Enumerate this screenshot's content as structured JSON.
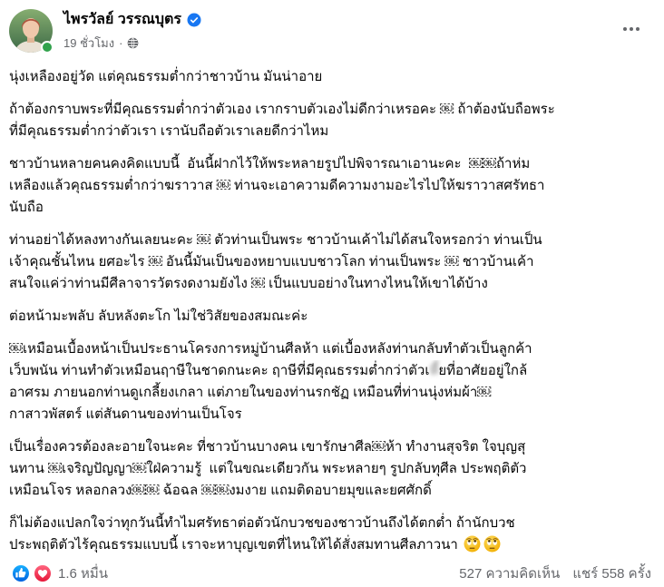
{
  "theme": {
    "accent": "#1877F2",
    "text": "#050505",
    "secondary_text": "#65676B",
    "online": "#31A24C",
    "love": "#F33E58"
  },
  "post": {
    "author": {
      "name": "ไพรวัลย์ วรรณบุตร",
      "verified": true,
      "online": true
    },
    "meta": {
      "time": "19 ชั่วโมง",
      "separator": "·",
      "audience_icon": "globe-icon"
    },
    "menu_icon": "more-horizontal-icon",
    "paragraphs": [
      {
        "lines": [
          "นุ่งเหลืองอยู่วัด แต่คุณธรรมต่ำกว่าชาวบ้าน มันน่าอาย"
        ]
      },
      {
        "lines": [
          "ถ้าต้องกราบพระที่มีคุณธรรมต่ำกว่าตัวเอง เรากราบตัวเองไม่ดีกว่าเหรอคะ ￼ ถ้าต้องนับถือพระ",
          "ที่มีคุณธรรมต่ำกว่าตัวเรา เรานับถือตัวเราเลยดีกว่าไหม"
        ]
      },
      {
        "lines": [
          "ชาวบ้านหลายคนคงคิดแบบนี้  อันนี้ฝากไว้ให้พระหลายรูปไปพิจารณาเอานะคะ  ￼￼ถ้าห่ม",
          "เหลืองแล้วคุณธรรมต่ำกว่าฆราวาส ￼ ท่านจะเอาความดีความงามอะไรไปให้ฆราวาสศรัทธา",
          "นับถือ"
        ]
      },
      {
        "lines": [
          "ท่านอย่าได้หลงทางกันเลยนะคะ ￼ ตัวท่านเป็นพระ ชาวบ้านเค้าไม่ได้สนใจหรอกว่า ท่านเป็น",
          "เจ้าคุณชั้นไหน ยศอะไร ￼ อันนี้มันเป็นของหยาบแบบชาวโลก ท่านเป็นพระ ￼ ชาวบ้านเค้า",
          "สนใจแค่ว่าท่านมีศีลาจารวัตรงดงามยังไง ￼ เป็นแบบอย่างในทางไหนให้เขาได้บ้าง"
        ]
      },
      {
        "lines": [
          "ต่อหน้ามะพลับ ลับหลังตะโก ไม่ใช่วิสัยของสมณะค่ะ"
        ]
      },
      {
        "lines": [
          "￼เหมือนเบื้องหน้าเป็นประธานโครงการหมู่บ้านศีลห้า แต่เบื้องหลังท่านกลับทำตัวเป็นลูกค้า",
          {
            "before": "เว็บพนัน ท่านทำตัวเหมือนฤาษีในชาดกนะคะ ฤาษีที่มีคุณธรรมต่ำกว่าตัวเ",
            "blurred": "หี้",
            "after": "ยที่อาศัยอยู่ใกล้"
          },
          "อาศรม ภายนอกท่านดูเกลี้ยงเกลา แต่ภายในของท่านรกชัฏ เหมือนที่ท่านนุ่งห่มผ้า￼",
          "กาสาวพัสตร์ แต่สันดานของท่านเป็นโจร"
        ]
      },
      {
        "lines": [
          "เป็นเรื่องควรต้องละอายใจนะคะ ที่ชาวบ้านบางคน เขารักษาศีล￼ห้า ทำงานสุจริต ใจบุญสุ",
          "นทาน ￼เจริญปัญญา￼ใฝ่ความรู้  แต่ในขณะเดียวกัน พระหลายๆ รูปกลับทุศีล ประพฤติตัว",
          "เหมือนโจร หลอกลวง￼￼ ฉ้อฉล ￼￼งมงาย แถมติดอบายมุขและยศศักดิ์"
        ]
      },
      {
        "lines": [
          "ก็ไม่ต้องแปลกใจว่าทุกวันนี้ทำไมศรัทธาต่อตัวนักบวชของชาวบ้านถึงได้ตกต่ำ ถ้านักบวช",
          "ประพฤติตัวไร้คุณธรรมแบบนี้ เราจะหาบุญเขตที่ไหนให้ได้สั่งสมทานศีลภาวนา"
        ],
        "emojis": [
          "face-with-rolling-eyes",
          "face-with-rolling-eyes"
        ]
      }
    ]
  },
  "footer": {
    "reactions": {
      "icons": [
        "like-icon",
        "love-icon"
      ],
      "count": "1.6 หมื่น"
    },
    "comments": "527 ความคิดเห็น",
    "shares": "แชร์ 558 ครั้ง"
  }
}
